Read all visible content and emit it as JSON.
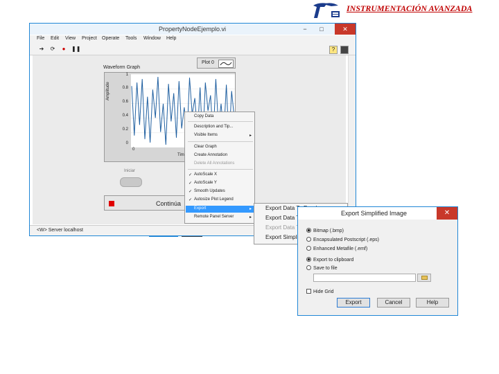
{
  "header": {
    "title": "INSTRUMENTACIÓN AVANZADA"
  },
  "window": {
    "title": "PropertyNodeEjemplo.vi",
    "controls": [
      "−",
      "□",
      "✕"
    ],
    "menu": [
      "File",
      "Edit",
      "View",
      "Project",
      "Operate",
      "Tools",
      "Window",
      "Help"
    ],
    "status": "<W> Server localhost"
  },
  "graph": {
    "label": "Waveform Graph",
    "legend": "Plot 0",
    "y_label": "Amplitude",
    "x_label": "Tim",
    "y_ticks": [
      "1",
      "0.8",
      "0.6",
      "0.4",
      "0.2",
      "0"
    ],
    "x_ticks": [
      "0"
    ],
    "line_color": "#1f5fa0"
  },
  "chart_data": {
    "type": "line",
    "title": "Waveform Graph",
    "xlabel": "Tim",
    "ylabel": "Amplitude",
    "ylim": [
      0,
      1
    ],
    "series": [
      {
        "name": "Plot 0",
        "values": [
          0.85,
          0.15,
          0.9,
          0.3,
          0.95,
          0.1,
          0.7,
          0.05,
          0.8,
          0.4,
          0.98,
          0.2,
          0.6,
          0.02,
          0.88,
          0.35,
          0.75,
          0.12,
          0.92,
          0.25,
          0.55,
          0.08,
          0.97,
          0.45,
          0.68,
          0.18,
          0.83,
          0.03,
          0.9,
          0.5,
          0.72,
          0.1,
          0.95,
          0.28,
          0.6,
          0.15,
          0.87,
          0.05,
          0.78,
          0.4
        ]
      }
    ]
  },
  "controls": {
    "iniciar": "Iniciar",
    "continue": "Continúa"
  },
  "context_menu": {
    "items": [
      {
        "label": "Copy Data",
        "check": "",
        "arrow": ""
      },
      {
        "label": "Description and Tip...",
        "check": "",
        "arrow": ""
      },
      {
        "label": "Visible Items",
        "check": "",
        "arrow": "▸"
      },
      {
        "label": "Clear Graph",
        "check": "",
        "arrow": ""
      },
      {
        "label": "Create Annotation",
        "check": "",
        "arrow": ""
      },
      {
        "label": "Delete All Annotations",
        "check": "",
        "arrow": ""
      },
      {
        "label": "AutoScale X",
        "check": "✓",
        "arrow": ""
      },
      {
        "label": "AutoScale Y",
        "check": "✓",
        "arrow": ""
      },
      {
        "label": "Smooth Updates",
        "check": "✓",
        "arrow": ""
      },
      {
        "label": "Autosize Plot Legend",
        "check": "✓",
        "arrow": ""
      },
      {
        "label": "Export",
        "check": "",
        "arrow": "▸"
      },
      {
        "label": "Remote Panel Server",
        "check": "",
        "arrow": "▸"
      }
    ]
  },
  "export_submenu": {
    "items": [
      "Export Data To Excel",
      "Export Data To Clipboard",
      "Export Data To DIAdem",
      "Export Simplified Image..."
    ]
  },
  "dialog": {
    "title": "Export Simplified Image",
    "close": "✕",
    "formats": [
      "Bitmap (.bmp)",
      "Encapsulated Postscript (.eps)",
      "Enhanced Metafile (.emf)"
    ],
    "destinations": [
      "Export to clipboard",
      "Save to file"
    ],
    "hide_grid": "Hide Grid",
    "buttons": {
      "export": "Export",
      "cancel": "Cancel",
      "help": "Help"
    }
  }
}
